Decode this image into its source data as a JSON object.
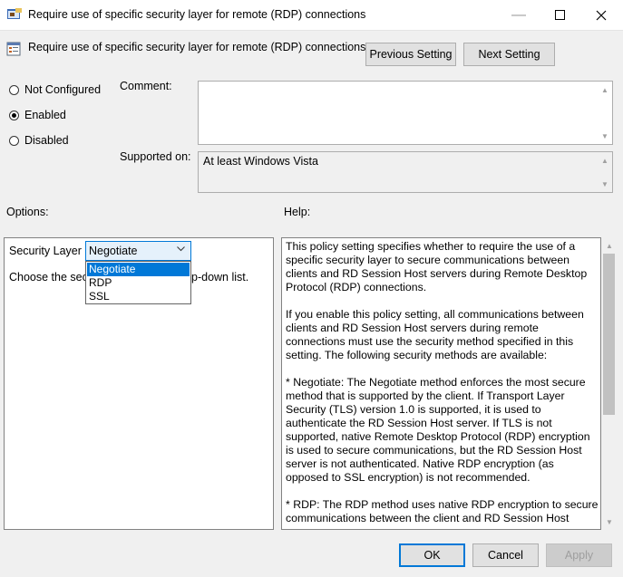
{
  "window": {
    "title": "Require use of specific security layer for remote (RDP) connections",
    "minimize_icon": "minimize-icon",
    "maximize_icon": "maximize-icon",
    "close_icon": "close-icon"
  },
  "header": {
    "setting_title": "Require use of specific security layer for remote (RDP) connections",
    "previous_label": "Previous Setting",
    "next_label": "Next Setting"
  },
  "state": {
    "options": [
      {
        "label": "Not Configured",
        "selected": false
      },
      {
        "label": "Enabled",
        "selected": true
      },
      {
        "label": "Disabled",
        "selected": false
      }
    ]
  },
  "comment": {
    "label": "Comment:",
    "value": ""
  },
  "supported": {
    "label": "Supported on:",
    "value": "At least Windows Vista"
  },
  "options_section": {
    "label": "Options:",
    "security_layer_label": "Security Layer",
    "security_layer_value": "Negotiate",
    "choose_text_start": "Choose the secu",
    "choose_text_end": "p-down list.",
    "dropdown_items": [
      "Negotiate",
      "RDP",
      "SSL"
    ]
  },
  "help_section": {
    "label": "Help:",
    "paragraphs": [
      "This policy setting specifies whether to require the use of a specific security layer to secure communications between clients and RD Session Host servers during Remote Desktop Protocol (RDP) connections.",
      "If you enable this policy setting, all communications between clients and RD Session Host servers during remote connections must use the security method specified in this setting. The following security methods are available:",
      "* Negotiate: The Negotiate method enforces the most secure method that is supported by the client. If Transport Layer Security (TLS) version 1.0 is supported, it is used to authenticate the RD Session Host server. If TLS is not supported, native Remote Desktop Protocol (RDP) encryption is used to secure communications, but the RD Session Host server is not authenticated. Native RDP encryption (as opposed to SSL encryption) is not recommended.",
      "* RDP: The RDP method uses native RDP encryption to secure communications between the client and RD Session Host server."
    ]
  },
  "footer": {
    "ok_label": "OK",
    "cancel_label": "Cancel",
    "apply_label": "Apply"
  },
  "colors": {
    "accent": "#0078d7",
    "background": "#f0f0f0"
  }
}
